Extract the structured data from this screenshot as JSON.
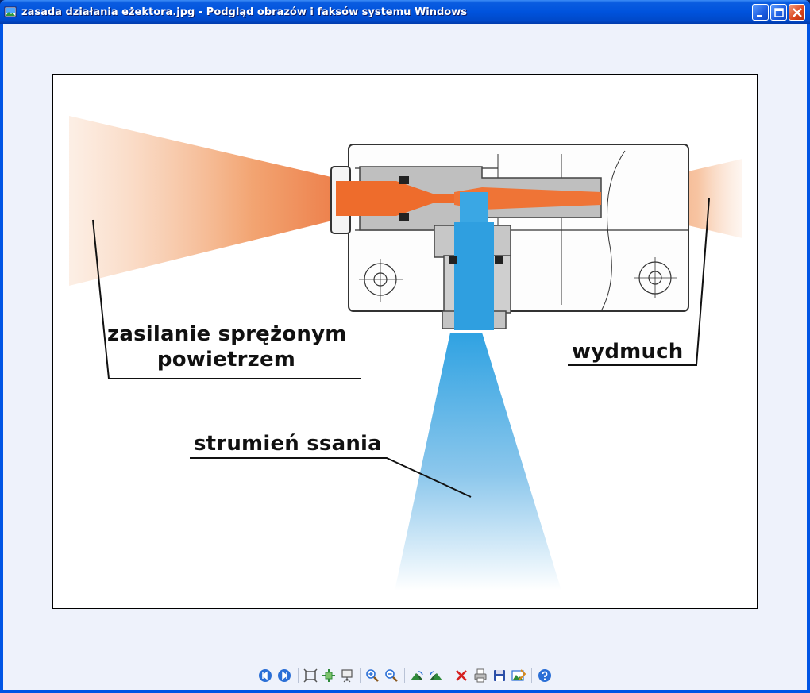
{
  "window": {
    "title": "zasada działania eżektora.jpg - Podgląd obrazów i faksów systemu Windows"
  },
  "image": {
    "labels": {
      "supply_line1": "zasilanie sprężonym",
      "supply_line2": "powietrzem",
      "exhaust": "wydmuch",
      "suction": "strumień ssania"
    }
  },
  "toolbar": {
    "buttons": [
      "previous-image",
      "next-image",
      "best-fit",
      "actual-size",
      "slideshow",
      "zoom-in",
      "zoom-out",
      "rotate-clockwise",
      "rotate-counterclockwise",
      "delete",
      "print",
      "copy-to",
      "open-for-editing",
      "help"
    ]
  },
  "colors": {
    "title_bar": "#0053dd",
    "client_bg": "#eef2fb",
    "orange_flow": "#f06a2a",
    "blue_flow": "#3aa0e0"
  }
}
